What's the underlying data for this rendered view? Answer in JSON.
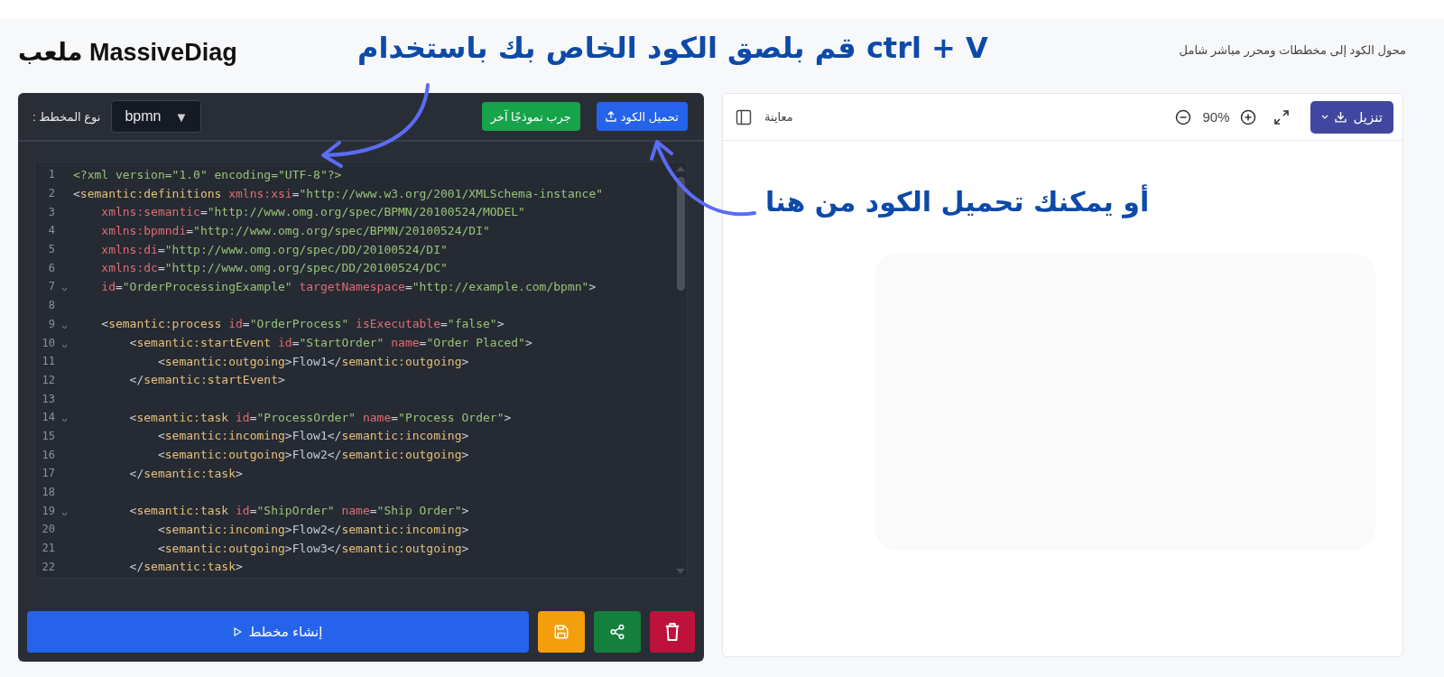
{
  "header": {
    "title": "MassiveDiag ملعب",
    "subtitle": "محول الكود إلى مخططات ومحرر مباشر شامل"
  },
  "annotations": [
    {
      "text": "قم بلصق الكود الخاص بك باستخدام ctrl + V"
    },
    {
      "text": "أو يمكنك تحميل الكود من هنا"
    }
  ],
  "editor": {
    "upload_button": "تحميل الكود",
    "sample_button": "جرب نموذجًا آخر",
    "diagram_type": {
      "value": "bpmn",
      "caret": "▼",
      "label": "نوع المخطط :"
    },
    "lines": [
      {
        "number": "1",
        "foldable": false,
        "tokens": [
          {
            "kind": "decl",
            "text": "<?xml version=\"1.0\" encoding=\"UTF-8\"?>"
          }
        ]
      },
      {
        "number": "2",
        "foldable": false,
        "tokens": [
          {
            "kind": "punct",
            "text": "<"
          },
          {
            "kind": "tag",
            "text": "semantic:definitions"
          },
          {
            "kind": "attr",
            "text": " xmlns:xsi"
          },
          {
            "kind": "punct",
            "text": "="
          },
          {
            "kind": "string",
            "text": "\"http://www.w3.org/2001/XMLSchema-instance\""
          }
        ]
      },
      {
        "number": "3",
        "foldable": false,
        "tokens": [
          {
            "kind": "attr",
            "text": "    xmlns:semantic"
          },
          {
            "kind": "punct",
            "text": "="
          },
          {
            "kind": "string",
            "text": "\"http://www.omg.org/spec/BPMN/20100524/MODEL\""
          }
        ]
      },
      {
        "number": "4",
        "foldable": false,
        "tokens": [
          {
            "kind": "attr",
            "text": "    xmlns:bpmndi"
          },
          {
            "kind": "punct",
            "text": "="
          },
          {
            "kind": "string",
            "text": "\"http://www.omg.org/spec/BPMN/20100524/DI\""
          }
        ]
      },
      {
        "number": "5",
        "foldable": false,
        "tokens": [
          {
            "kind": "attr",
            "text": "    xmlns:di"
          },
          {
            "kind": "punct",
            "text": "="
          },
          {
            "kind": "string",
            "text": "\"http://www.omg.org/spec/DD/20100524/DI\""
          }
        ]
      },
      {
        "number": "6",
        "foldable": false,
        "tokens": [
          {
            "kind": "attr",
            "text": "    xmlns:dc"
          },
          {
            "kind": "punct",
            "text": "="
          },
          {
            "kind": "string",
            "text": "\"http://www.omg.org/spec/DD/20100524/DC\""
          }
        ]
      },
      {
        "number": "7",
        "foldable": true,
        "tokens": [
          {
            "kind": "attr",
            "text": "    id"
          },
          {
            "kind": "punct",
            "text": "="
          },
          {
            "kind": "string",
            "text": "\"OrderProcessingExample\""
          },
          {
            "kind": "attr",
            "text": " targetNamespace"
          },
          {
            "kind": "punct",
            "text": "="
          },
          {
            "kind": "string",
            "text": "\"http://example.com/bpmn\""
          },
          {
            "kind": "punct",
            "text": ">"
          }
        ]
      },
      {
        "number": "8",
        "foldable": false
      },
      {
        "number": "9",
        "foldable": true,
        "tokens": [
          {
            "kind": "punct",
            "text": "    <"
          },
          {
            "kind": "tag",
            "text": "semantic:process"
          },
          {
            "kind": "attr",
            "text": " id"
          },
          {
            "kind": "punct",
            "text": "="
          },
          {
            "kind": "string",
            "text": "\"OrderProcess\""
          },
          {
            "kind": "attr",
            "text": " isExecutable"
          },
          {
            "kind": "punct",
            "text": "="
          },
          {
            "kind": "string",
            "text": "\"false\""
          },
          {
            "kind": "punct",
            "text": ">"
          }
        ]
      },
      {
        "number": "10",
        "foldable": true,
        "tokens": [
          {
            "kind": "punct",
            "text": "        <"
          },
          {
            "kind": "tag",
            "text": "semantic:startEvent"
          },
          {
            "kind": "attr",
            "text": " id"
          },
          {
            "kind": "punct",
            "text": "="
          },
          {
            "kind": "string",
            "text": "\"StartOrder\""
          },
          {
            "kind": "attr",
            "text": " name"
          },
          {
            "kind": "punct",
            "text": "="
          },
          {
            "kind": "string",
            "text": "\"Order Placed\""
          },
          {
            "kind": "punct",
            "text": ">"
          }
        ]
      },
      {
        "number": "11",
        "foldable": false,
        "tokens": [
          {
            "kind": "punct",
            "text": "            <"
          },
          {
            "kind": "tag",
            "text": "semantic:outgoing"
          },
          {
            "kind": "punct",
            "text": ">"
          },
          {
            "kind": "text",
            "text": "Flow1"
          },
          {
            "kind": "punct",
            "text": "</"
          },
          {
            "kind": "tag",
            "text": "semantic:outgoing"
          },
          {
            "kind": "punct",
            "text": ">"
          }
        ]
      },
      {
        "number": "12",
        "foldable": false,
        "tokens": [
          {
            "kind": "punct",
            "text": "        </"
          },
          {
            "kind": "tag",
            "text": "semantic:startEvent"
          },
          {
            "kind": "punct",
            "text": ">"
          }
        ]
      },
      {
        "number": "13",
        "foldable": false
      },
      {
        "number": "14",
        "foldable": true,
        "tokens": [
          {
            "kind": "punct",
            "text": "        <"
          },
          {
            "kind": "tag",
            "text": "semantic:task"
          },
          {
            "kind": "attr",
            "text": " id"
          },
          {
            "kind": "punct",
            "text": "="
          },
          {
            "kind": "string",
            "text": "\"ProcessOrder\""
          },
          {
            "kind": "attr",
            "text": " name"
          },
          {
            "kind": "punct",
            "text": "="
          },
          {
            "kind": "string",
            "text": "\"Process Order\""
          },
          {
            "kind": "punct",
            "text": ">"
          }
        ]
      },
      {
        "number": "15",
        "foldable": false,
        "tokens": [
          {
            "kind": "punct",
            "text": "            <"
          },
          {
            "kind": "tag",
            "text": "semantic:incoming"
          },
          {
            "kind": "punct",
            "text": ">"
          },
          {
            "kind": "text",
            "text": "Flow1"
          },
          {
            "kind": "punct",
            "text": "</"
          },
          {
            "kind": "tag",
            "text": "semantic:incoming"
          },
          {
            "kind": "punct",
            "text": ">"
          }
        ]
      },
      {
        "number": "16",
        "foldable": false,
        "tokens": [
          {
            "kind": "punct",
            "text": "            <"
          },
          {
            "kind": "tag",
            "text": "semantic:outgoing"
          },
          {
            "kind": "punct",
            "text": ">"
          },
          {
            "kind": "text",
            "text": "Flow2"
          },
          {
            "kind": "punct",
            "text": "</"
          },
          {
            "kind": "tag",
            "text": "semantic:outgoing"
          },
          {
            "kind": "punct",
            "text": ">"
          }
        ]
      },
      {
        "number": "17",
        "foldable": false,
        "tokens": [
          {
            "kind": "punct",
            "text": "        </"
          },
          {
            "kind": "tag",
            "text": "semantic:task"
          },
          {
            "kind": "punct",
            "text": ">"
          }
        ]
      },
      {
        "number": "18",
        "foldable": false
      },
      {
        "number": "19",
        "foldable": true,
        "tokens": [
          {
            "kind": "punct",
            "text": "        <"
          },
          {
            "kind": "tag",
            "text": "semantic:task"
          },
          {
            "kind": "attr",
            "text": " id"
          },
          {
            "kind": "punct",
            "text": "="
          },
          {
            "kind": "string",
            "text": "\"ShipOrder\""
          },
          {
            "kind": "attr",
            "text": " name"
          },
          {
            "kind": "punct",
            "text": "="
          },
          {
            "kind": "string",
            "text": "\"Ship Order\""
          },
          {
            "kind": "punct",
            "text": ">"
          }
        ]
      },
      {
        "number": "20",
        "foldable": false,
        "tokens": [
          {
            "kind": "punct",
            "text": "            <"
          },
          {
            "kind": "tag",
            "text": "semantic:incoming"
          },
          {
            "kind": "punct",
            "text": ">"
          },
          {
            "kind": "text",
            "text": "Flow2"
          },
          {
            "kind": "punct",
            "text": "</"
          },
          {
            "kind": "tag",
            "text": "semantic:incoming"
          },
          {
            "kind": "punct",
            "text": ">"
          }
        ]
      },
      {
        "number": "21",
        "foldable": false,
        "tokens": [
          {
            "kind": "punct",
            "text": "            <"
          },
          {
            "kind": "tag",
            "text": "semantic:outgoing"
          },
          {
            "kind": "punct",
            "text": ">"
          },
          {
            "kind": "text",
            "text": "Flow3"
          },
          {
            "kind": "punct",
            "text": "</"
          },
          {
            "kind": "tag",
            "text": "semantic:outgoing"
          },
          {
            "kind": "punct",
            "text": ">"
          }
        ]
      },
      {
        "number": "22",
        "foldable": false,
        "tokens": [
          {
            "kind": "punct",
            "text": "        </"
          },
          {
            "kind": "tag",
            "text": "semantic:task"
          },
          {
            "kind": "punct",
            "text": ">"
          }
        ]
      }
    ],
    "generate_button": "إنشاء مخطط"
  },
  "preview": {
    "label": "معاينة",
    "zoom": "90%",
    "download_button": "تنزيل"
  }
}
